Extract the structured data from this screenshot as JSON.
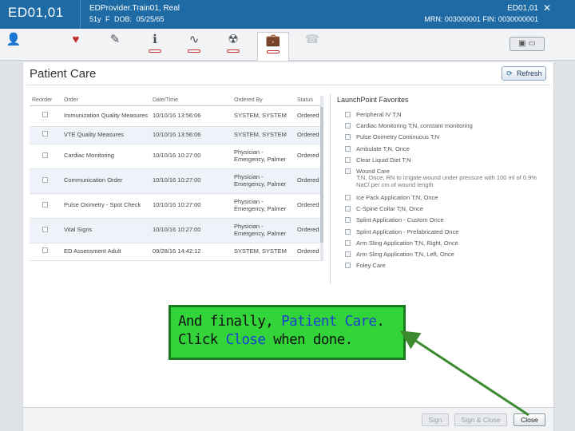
{
  "header": {
    "encounter_id": "ED01,01",
    "patient_name": "EDProvider.Train01, Real",
    "demographics": "51y   F   DOB: 05/25/65",
    "right_id": "ED01,01",
    "mrn_fin": "MRN: 003000001  FIN: 0030000001",
    "close_glyph": "✕"
  },
  "toolbar": {
    "icons": [
      {
        "name": "patient-profile-icon",
        "glyph": "👤"
      },
      {
        "name": "heart-icon",
        "glyph": "♥"
      },
      {
        "name": "medication-icon",
        "glyph": "✎"
      },
      {
        "name": "iv-line-icon",
        "glyph": "ℹ"
      },
      {
        "name": "vitals-waveform-icon",
        "glyph": "∿"
      },
      {
        "name": "radiology-icon",
        "glyph": "☢"
      },
      {
        "name": "patient-care-icon",
        "glyph": "💼"
      },
      {
        "name": "phone-icon",
        "glyph": "☎"
      }
    ],
    "right_button": "▣ ▭"
  },
  "main": {
    "title": "Patient Care",
    "refresh_label": "Refresh",
    "refresh_glyph": "⟳"
  },
  "orders": {
    "columns": [
      "Reorder",
      "Order",
      "Date/Time",
      "Ordered By",
      "Status"
    ],
    "rows": [
      {
        "order": "Immunization Quality Measures",
        "datetime": "10/10/16 13:56:06",
        "ordered_by": "SYSTEM, SYSTEM",
        "status": "Ordered"
      },
      {
        "order": "VTE Quality Measures",
        "datetime": "10/10/16 13:56:06",
        "ordered_by": "SYSTEM, SYSTEM",
        "status": "Ordered"
      },
      {
        "order": "Cardiac Monitoring",
        "datetime": "10/10/16 10:27:00",
        "ordered_by": "Physician - Emergency, Palmer",
        "status": "Ordered"
      },
      {
        "order": "Communication Order",
        "datetime": "10/10/16 10:27:00",
        "ordered_by": "Physician - Emergency, Palmer",
        "status": "Ordered"
      },
      {
        "order": "Pulse Oximetry - Spot Check",
        "datetime": "10/10/16 10:27:00",
        "ordered_by": "Physician - Emergency, Palmer",
        "status": "Ordered"
      },
      {
        "order": "Vital Signs",
        "datetime": "10/10/16 10:27:00",
        "ordered_by": "Physician - Emergency, Palmer",
        "status": "Ordered"
      },
      {
        "order": "ED Assessment Adult",
        "datetime": "09/28/16 14:42:12",
        "ordered_by": "SYSTEM, SYSTEM",
        "status": "Ordered"
      }
    ]
  },
  "favorites": {
    "title": "LaunchPoint Favorites",
    "items": [
      {
        "label": "Peripheral IV T;N",
        "detail": ""
      },
      {
        "label": "Cardiac Monitoring T;N, constant monitoring",
        "detail": ""
      },
      {
        "label": "Pulse Oximetry Continuous T;N",
        "detail": ""
      },
      {
        "label": "Ambulate T;N, Once",
        "detail": ""
      },
      {
        "label": "Clear Liquid Diet T;N",
        "detail": ""
      },
      {
        "label": "Wound Care",
        "detail": "T;N, Once, RN to irrigate wound under pressure with 100 ml of 0.9% NaCl per cm of wound length"
      },
      {
        "label": "Ice Pack Application T;N, Once",
        "detail": ""
      },
      {
        "label": "C-Spine Collar T;N, Once",
        "detail": ""
      },
      {
        "label": "Splint Application - Custom Once",
        "detail": ""
      },
      {
        "label": "Splint Application - Prefabricated Once",
        "detail": ""
      },
      {
        "label": "Arm Sling Application T;N, Right, Once",
        "detail": ""
      },
      {
        "label": "Arm Sling Application T;N, Left, Once",
        "detail": ""
      },
      {
        "label": "Foley Care",
        "detail": ""
      }
    ]
  },
  "callout": {
    "line1_prefix": "And finally, ",
    "line1_highlight": "Patient Care",
    "line1_suffix": ".",
    "line2_prefix": "Click ",
    "line2_highlight": "Close",
    "line2_suffix": " when done.",
    "highlight_color": "#1b3fd1",
    "background_color": "#33d43a"
  },
  "footer": {
    "sign_label": "Sign",
    "sign_close_label": "Sign & Close",
    "close_label": "Close"
  }
}
